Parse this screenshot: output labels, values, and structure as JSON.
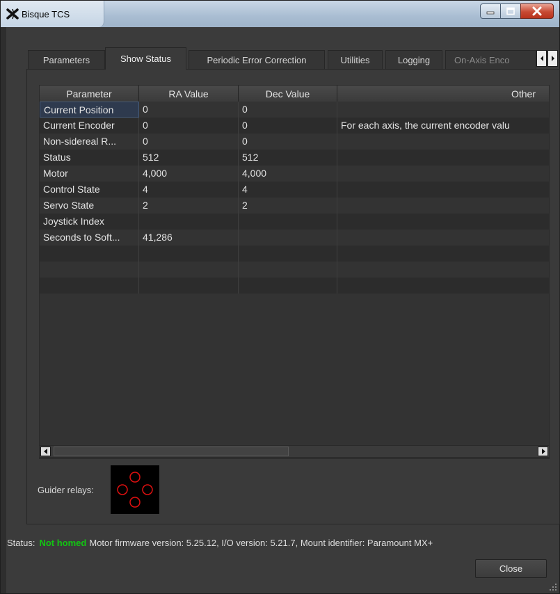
{
  "window": {
    "title": "Bisque TCS",
    "minimize_icon": "minimize-icon",
    "maximize_icon": "maximize-icon",
    "close_icon": "close-icon"
  },
  "tabs": [
    {
      "label": "Parameters",
      "active": false
    },
    {
      "label": "Show Status",
      "active": true
    },
    {
      "label": "Periodic Error Correction",
      "active": false
    },
    {
      "label": "Utilities",
      "active": false
    },
    {
      "label": "Logging",
      "active": false
    },
    {
      "label": "On-Axis Enco",
      "active": false
    }
  ],
  "table": {
    "columns": [
      "Parameter",
      "RA Value",
      "Dec Value",
      "Other"
    ],
    "rows": [
      [
        "Current Position",
        "0",
        "0",
        ""
      ],
      [
        "Current Encoder",
        "0",
        "0",
        "For each axis, the current encoder valu"
      ],
      [
        "Non-sidereal R...",
        "0",
        "0",
        ""
      ],
      [
        "Status",
        "512",
        "512",
        ""
      ],
      [
        "Motor",
        "4,000",
        "4,000",
        ""
      ],
      [
        "Control State",
        "4",
        "4",
        ""
      ],
      [
        "Servo State",
        "2",
        "2",
        ""
      ],
      [
        "Joystick Index",
        "",
        "",
        ""
      ],
      [
        "Seconds to Soft...",
        "41,286",
        "",
        ""
      ],
      [
        "",
        "",
        "",
        ""
      ],
      [
        "",
        "",
        "",
        ""
      ],
      [
        "",
        "",
        "",
        ""
      ]
    ]
  },
  "guider": {
    "label": "Guider relays:"
  },
  "status": {
    "prefix": "Status:",
    "homed_state": "Not homed",
    "details": "Motor firmware version: 5.25.12, I/O version: 5.21.7, Mount identifier: Paramount MX+"
  },
  "buttons": {
    "close": "Close"
  },
  "colors": {
    "status_ok": "#13c413",
    "relay_ring": "#e01010",
    "selection": "#2e3a4e"
  }
}
